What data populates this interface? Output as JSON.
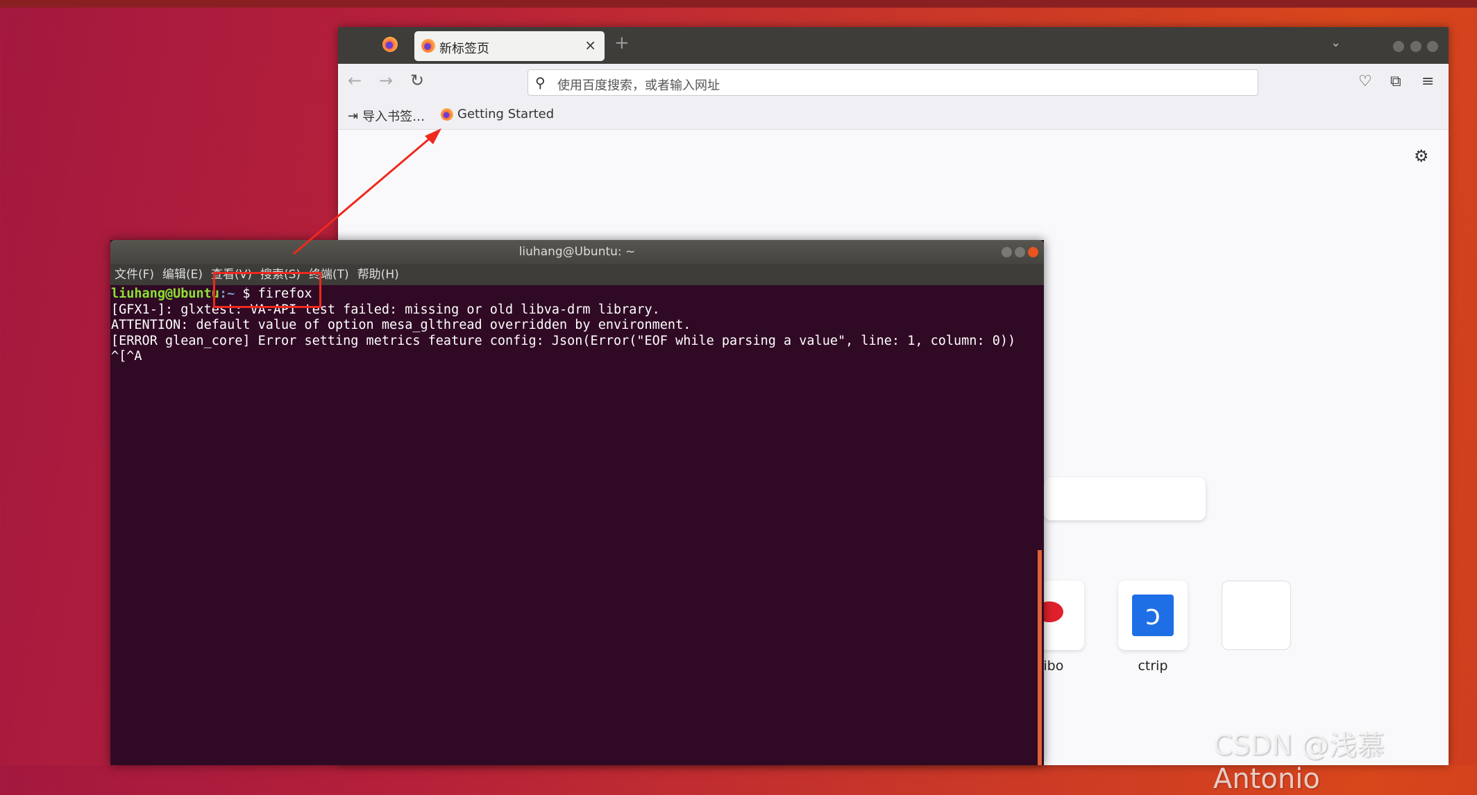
{
  "browser": {
    "tab": {
      "title": "新标签页",
      "close": "×"
    },
    "new_tab": "+",
    "dropdown": "⌄",
    "url_placeholder": "使用百度搜索，或者输入网址",
    "bookmarks": [
      {
        "label": "导入书签…",
        "icon": "import-icon"
      },
      {
        "label": "Getting Started",
        "icon": "firefox-icon"
      }
    ],
    "nav": {
      "back": "←",
      "forward": "→",
      "reload": "↻"
    },
    "toolbar_icons": [
      "pocket-icon",
      "extensions-icon",
      "menu-icon"
    ],
    "settings_icon": "⚙",
    "top_sites": [
      {
        "label": "eibo",
        "icon": "weibo-icon"
      },
      {
        "label": "ctrip",
        "icon": "ctrip-icon"
      },
      {
        "label": "",
        "icon": ""
      }
    ]
  },
  "terminal": {
    "title": "liuhang@Ubuntu: ~",
    "menu": [
      "文件(F)",
      "编辑(E)",
      "查看(V)",
      "搜索(S)",
      "终端(T)",
      "帮助(H)"
    ],
    "prompt_user": "liuhang@Ubuntu",
    "prompt_path": ":~",
    "command": "$ firefox",
    "output": [
      "[GFX1-]: glxtest: VA-API test failed: missing or old libva-drm library.",
      "ATTENTION: default value of option mesa_glthread overridden by environment.",
      "[ERROR glean_core] Error setting metrics feature config: Json(Error(\"EOF while parsing a value\", line: 1, column: 0))",
      "^[^A"
    ]
  },
  "annotation_color": "#f0281e",
  "watermark": "CSDN @浅慕Antonio"
}
